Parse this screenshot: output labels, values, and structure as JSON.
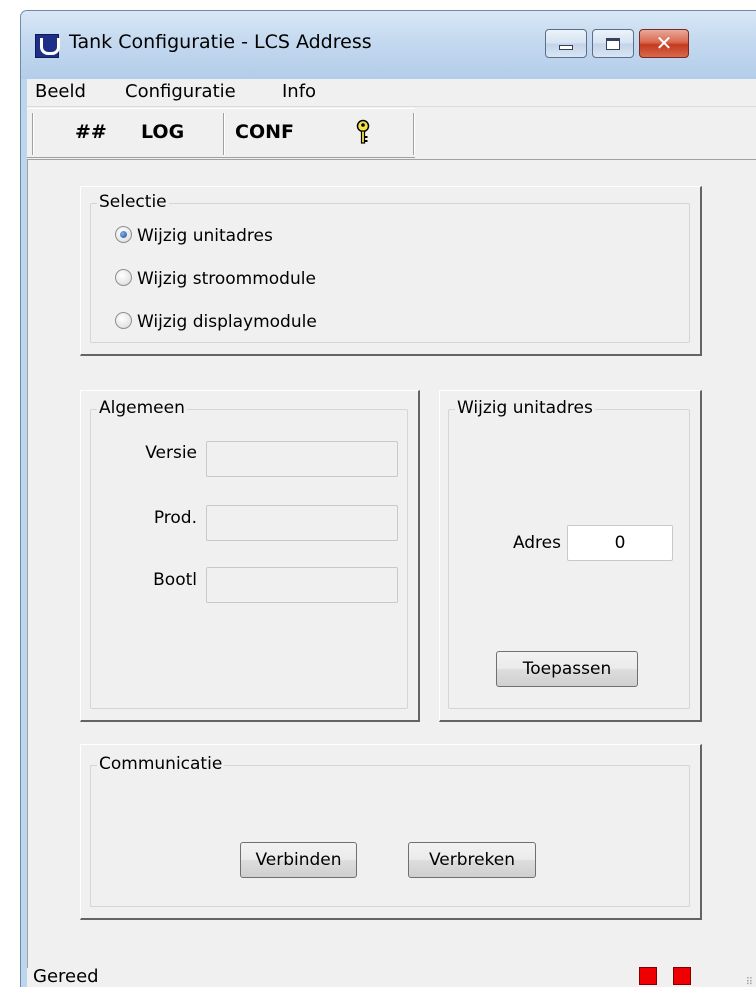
{
  "window": {
    "title": "Tank Configuratie - LCS Address",
    "close_glyph": "✕"
  },
  "menu": {
    "items": [
      "Beeld",
      "Configuratie",
      "Info"
    ]
  },
  "toolbar": {
    "buttons": [
      "##",
      "LOG",
      "CONF"
    ],
    "help_icon": "key-help-icon"
  },
  "selectie": {
    "legend": "Selectie",
    "options": [
      {
        "label": "Wijzig unitadres",
        "checked": true
      },
      {
        "label": "Wijzig stroommodule",
        "checked": false
      },
      {
        "label": "Wijzig displaymodule",
        "checked": false
      }
    ]
  },
  "algemeen": {
    "legend": "Algemeen",
    "fields": [
      {
        "label": "Versie",
        "value": ""
      },
      {
        "label": "Prod.",
        "value": ""
      },
      {
        "label": "Bootl",
        "value": ""
      }
    ]
  },
  "unitadres": {
    "legend": "Wijzig unitadres",
    "adres_label": "Adres",
    "adres_value": "0",
    "apply_label": "Toepassen"
  },
  "communicatie": {
    "legend": "Communicatie",
    "connect_label": "Verbinden",
    "disconnect_label": "Verbreken"
  },
  "status": {
    "text": "Gereed",
    "led_color": "#ee0000"
  }
}
